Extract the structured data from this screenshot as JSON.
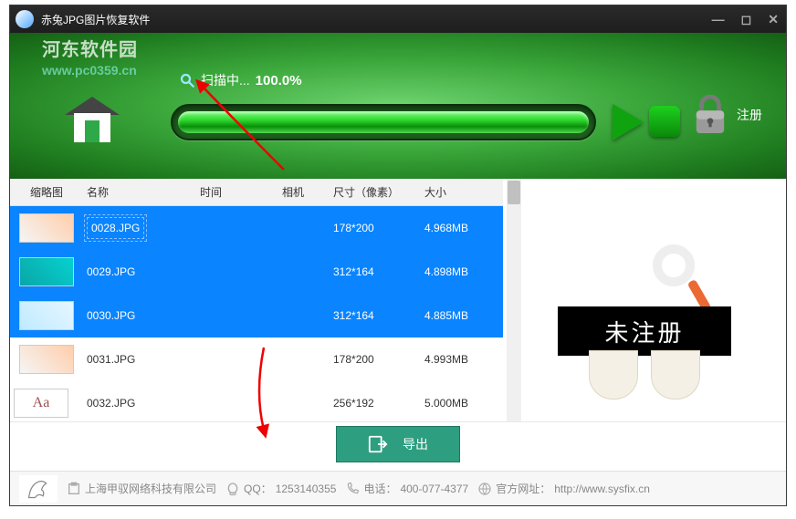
{
  "title": "赤兔JPG图片恢复软件",
  "watermark": {
    "text": "河东软件园",
    "url": "www.pc0359.cn"
  },
  "scan": {
    "label": "扫描中...",
    "percent": "100.0%"
  },
  "register_label": "注册",
  "columns": {
    "thumb": "缩略图",
    "name": "名称",
    "time": "时间",
    "camera": "相机",
    "dim": "尺寸（像素）",
    "size": "大小"
  },
  "rows": [
    {
      "name": "0028.JPG",
      "time": "",
      "camera": "",
      "dim": "178*200",
      "size": "4.968MB",
      "thumb": "t1",
      "selected": true,
      "first": true
    },
    {
      "name": "0029.JPG",
      "time": "",
      "camera": "",
      "dim": "312*164",
      "size": "4.898MB",
      "thumb": "t2",
      "selected": true
    },
    {
      "name": "0030.JPG",
      "time": "",
      "camera": "",
      "dim": "312*164",
      "size": "4.885MB",
      "thumb": "t3",
      "selected": true
    },
    {
      "name": "0031.JPG",
      "time": "",
      "camera": "",
      "dim": "178*200",
      "size": "4.993MB",
      "thumb": "t1",
      "selected": false
    },
    {
      "name": "0032.JPG",
      "time": "",
      "camera": "",
      "dim": "256*192",
      "size": "5.000MB",
      "thumb": "t5",
      "selected": false,
      "thumb_text": "Aa"
    }
  ],
  "preview_band": "未注册",
  "export_label": "导出",
  "footer": {
    "company": "上海甲驭网络科技有限公司",
    "qq_label": "QQ：",
    "qq": "1253140355",
    "tel_label": "电话：",
    "tel": "400-077-4377",
    "site_label": "官方网址：",
    "site": "http://www.sysfix.cn"
  }
}
